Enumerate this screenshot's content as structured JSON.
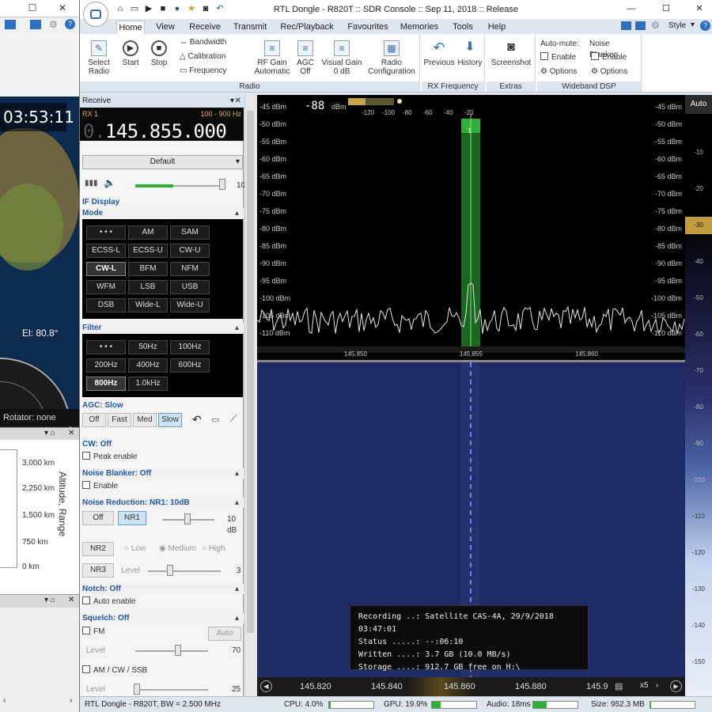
{
  "left_window": {
    "clock": "03:53:11",
    "elevation": "El: 80.8°",
    "rotator": "Rotator: none",
    "altitude_ticks": [
      "3,000 km",
      "2,250 km",
      "1,500 km",
      "750 km",
      "0 km"
    ],
    "altitude_axis": "Altitude, Range"
  },
  "title": "RTL Dongle - R820T :: SDR Console :: Sep 11, 2018 :: Release",
  "style_label": "Style",
  "tabs": [
    "Home",
    "View",
    "Receive",
    "Transmit",
    "Rec/Playback",
    "Favourites",
    "Memories",
    "Tools",
    "Help"
  ],
  "ribbon": {
    "select_radio": "Select Radio",
    "start": "Start",
    "stop": "Stop",
    "bandwidth": "Bandwidth",
    "calibration": "Calibration",
    "frequency": "Frequency",
    "rf_gain": "RF Gain",
    "rf_gain_val": "Automatic",
    "agc": "AGC",
    "agc_val": "Off",
    "visual_gain": "Visual Gain",
    "visual_gain_val": "0 dB",
    "radio_config": "Radio Configuration",
    "group_radio": "Radio",
    "previous": "Previous",
    "history": "History",
    "group_rxfreq": "RX Frequency",
    "screenshot": "Screenshot",
    "group_extras": "Extras",
    "automute": "Auto-mute:",
    "noise_blanker": "Noise Blanker:",
    "enable": "Enable",
    "options": "Options",
    "group_wdsp": "Wideband DSP"
  },
  "receive": {
    "header": "Receive",
    "rx": "RX 1",
    "range": "100 - 900 Hz",
    "freq_dim": "0.",
    "freq": "145.855.000",
    "preset": "Default",
    "vol_end": "10",
    "if_display": "IF Display",
    "mode": "Mode",
    "modes": [
      "• • •",
      "AM",
      "SAM",
      "ECSS-L",
      "ECSS-U",
      "CW-U",
      "CW-L",
      "BFM",
      "NFM",
      "WFM",
      "LSB",
      "USB",
      "DSB",
      "Wide-L",
      "Wide-U"
    ],
    "filter": "Filter",
    "filters": [
      "• • •",
      "50Hz",
      "100Hz",
      "200Hz",
      "400Hz",
      "600Hz",
      "800Hz",
      "1.0kHz"
    ],
    "agc_title": "AGC: Slow",
    "agc_btns": [
      "Off",
      "Fast",
      "Med",
      "Slow"
    ],
    "cw": "CW: Off",
    "peak": "Peak enable",
    "nb": "Noise Blanker: Off",
    "nb_enable": "Enable",
    "nr": "Noise Reduction: NR1: 10dB",
    "nr_off": "Off",
    "nr1": "NR1",
    "nr_val": "10 dB",
    "nr2": "NR2",
    "low": "Low",
    "medium": "Medium",
    "high": "High",
    "nr3": "NR3",
    "level": "Level",
    "nr3_val": "3",
    "notch": "Notch: Off",
    "auto_enable": "Auto enable",
    "squelch": "Squelch: Off",
    "fm": "FM",
    "auto": "Auto",
    "fm_level_val": "70",
    "amcw": "AM / CW / SSB",
    "am_level_val": "25"
  },
  "spectrum": {
    "readout": "-88",
    "readout_unit": "dBm",
    "mini_scale": [
      "-120",
      "-100",
      "-80",
      "-60",
      "-40",
      "-20"
    ],
    "db_labels": [
      "-45 dBm",
      "-50 dBm",
      "-55 dBm",
      "-60 dBm",
      "-65 dBm",
      "-70 dBm",
      "-75 dBm",
      "-80 dBm",
      "-85 dBm",
      "-90 dBm",
      "-95 dBm",
      "-100 dBm",
      "-105 dBm",
      "-110 dBm"
    ],
    "freq_labels": [
      "145.850",
      "145.855",
      "145.860"
    ],
    "marker": "1"
  },
  "recording": {
    "line1": "Recording ..: Satellite CAS-4A,  29/9/2018 03:47:01",
    "line2": "Status .....: --:06:10",
    "line3": "Written ....: 3.7 GB (10.0 MB/s)",
    "line4": "Storage ....: 912.7 GB free on H:\\"
  },
  "freq_scale": [
    "145.820",
    "145.840",
    "145.860",
    "145.880",
    "145.9"
  ],
  "zoom": "x5",
  "smeter": {
    "auto": "Auto",
    "labels": [
      "-10",
      "-20",
      "-30",
      "-40",
      "-50",
      "-60",
      "-70",
      "-80",
      "-90",
      "-100",
      "-110",
      "-120",
      "-130",
      "-140",
      "-150"
    ]
  },
  "status": {
    "device": "RTL Dongle - R820T, BW = 2.500 MHz",
    "cpu": "CPU: 4.0%",
    "gpu": "GPU: 19.9%",
    "audio": "Audio: 18ms",
    "size": "Size: 952.3 MB",
    "cpu_fraction": 0.04,
    "gpu_fraction": 0.2,
    "audio_fraction": 0.3,
    "size_fraction": 0.02
  },
  "colors": {
    "accent": "#2456a6",
    "signal": "#2fae3a",
    "meter_yellow": "#e4b64d"
  }
}
